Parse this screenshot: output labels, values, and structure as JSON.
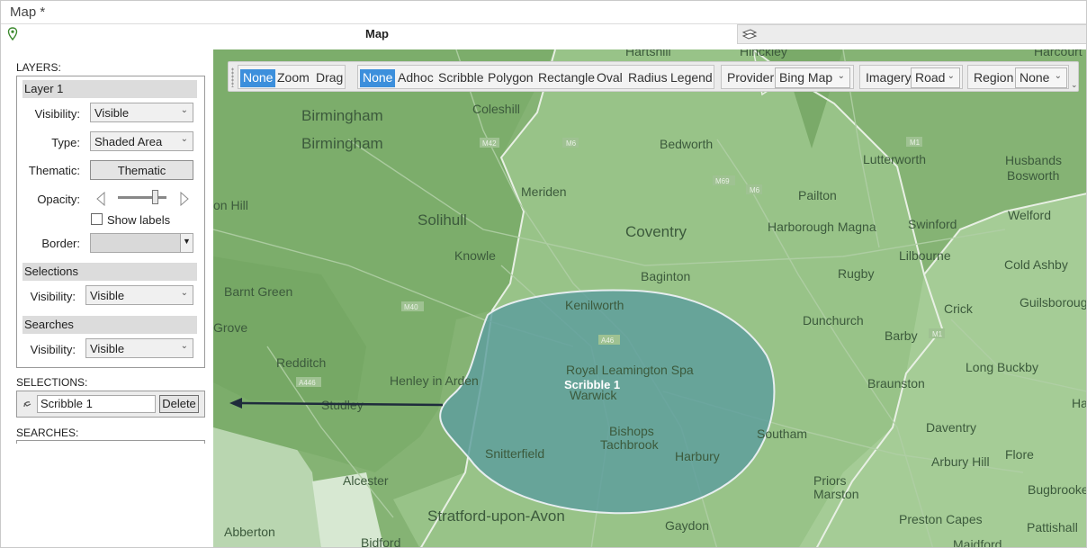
{
  "window": {
    "title": "Map *"
  },
  "header": {
    "map_title": "Map"
  },
  "left_panel": {
    "layers_label": "LAYERS:",
    "layer": {
      "name": "Layer 1",
      "visibility_label": "Visibility:",
      "visibility_value": "Visible",
      "type_label": "Type:",
      "type_value": "Shaded Area",
      "thematic_label": "Thematic:",
      "thematic_button": "Thematic",
      "opacity_label": "Opacity:",
      "show_labels": "Show labels",
      "border_label": "Border:"
    },
    "selections_group": {
      "title": "Selections",
      "visibility_label": "Visibility:",
      "visibility_value": "Visible"
    },
    "searches_group": {
      "title": "Searches",
      "visibility_label": "Visibility:",
      "visibility_value": "Visible"
    },
    "selections_label": "SELECTIONS:",
    "selection_item": "Scribble 1",
    "delete_button": "Delete",
    "searches_label": "SEARCHES:"
  },
  "toolbar": {
    "nav": [
      "None",
      "Zoom",
      "Drag"
    ],
    "draw": [
      "None",
      "Adhoc",
      "Scribble",
      "Polygon",
      "Rectangle",
      "Oval",
      "Radius",
      "Legend"
    ],
    "provider_label": "Provider",
    "provider_value": "Bing Map",
    "imagery_label": "Imagery",
    "imagery_value": "Road",
    "region_label": "Region",
    "region_value": "None"
  },
  "map": {
    "selection_label": "Scribble 1",
    "places": [
      "Hartshill",
      "Hinckley",
      "Harcourt",
      "Birmingham",
      "Birmingham",
      "Coleshill",
      "Bedworth",
      "Lutterworth",
      "Husbands Bosworth",
      "Meriden",
      "Pailton",
      "Solihull",
      "Coventry",
      "Harborough Magna",
      "Swinford",
      "Welford",
      "Knowle",
      "Lilbourne",
      "Cold Ashby",
      "Baginton",
      "Rugby",
      "Barnt Green",
      "Guilsborough",
      "Kenilworth",
      "Crick",
      "Dunchurch",
      "Barby",
      "Redditch",
      "Royal Leamington Spa",
      "Long Buckby",
      "Henley in Arden",
      "Warwick",
      "Braunston",
      "Studley",
      "Bishops Tachbrook",
      "Southam",
      "Daventry",
      "Harlestone",
      "Snitterfield",
      "Harbury",
      "Arbury Hill",
      "Flore",
      "Alcester",
      "Priors Marston",
      "Bugbrooke",
      "Stratford-upon-Avon",
      "Preston Capes",
      "Abberton",
      "Gaydon",
      "Pattishall",
      "Bidford",
      "Maidford",
      "on Hill",
      "Grove"
    ],
    "road_labels": [
      "M42",
      "M6",
      "M69",
      "M6",
      "M1",
      "M40",
      "A46",
      "M1",
      "A446"
    ]
  },
  "colors": {
    "selection_fill": "#5d9e9d",
    "toolbar_selected": "#3c8fdc",
    "map_base": "#86b476"
  }
}
